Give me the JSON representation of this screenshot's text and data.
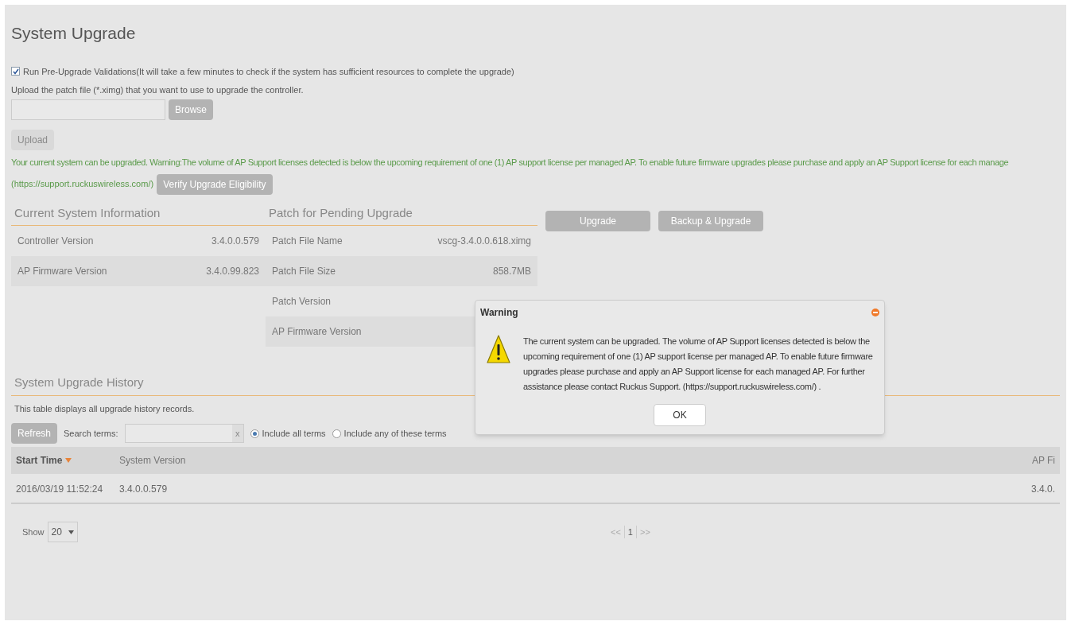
{
  "page": {
    "title": "System Upgrade"
  },
  "validation": {
    "checked": true,
    "label": "Run Pre-Upgrade Validations(It will take a few minutes to check if the system has sufficient resources to complete the upgrade)"
  },
  "upload": {
    "instruction": "Upload the patch file (*.ximg) that you want to use to upgrade the controller.",
    "browse": {
      "label": "Browse",
      "disabled": false
    },
    "upload": {
      "label": "Upload",
      "disabled": true
    }
  },
  "eligibility": {
    "message": "Your current system can be upgraded. Warning:The volume of AP Support licenses detected is below the upcoming requirement of one (1) AP support license per managed AP. To enable future firmware upgrades please purchase and apply an AP Support license for each manage",
    "link": "(https://support.ruckuswireless.com/)",
    "button": {
      "label": "Verify Upgrade Eligibility",
      "disabled": false
    }
  },
  "current_system": {
    "heading": "Current System Information",
    "rows": [
      {
        "label": "Controller Version",
        "value": "3.4.0.0.579"
      },
      {
        "label": "AP Firmware Version",
        "value": "3.4.0.99.823"
      }
    ]
  },
  "pending_patch": {
    "heading": "Patch for Pending Upgrade",
    "rows": [
      {
        "label": "Patch File Name",
        "value": "vscg-3.4.0.0.618.ximg"
      },
      {
        "label": "Patch File Size",
        "value": "858.7MB"
      },
      {
        "label": "Patch Version"
      },
      {
        "label": "AP Firmware Version"
      }
    ]
  },
  "actions": [
    {
      "label": "Upgrade",
      "disabled": false
    },
    {
      "label": "Backup & Upgrade",
      "disabled": false
    }
  ],
  "history": {
    "heading": "System Upgrade History",
    "description": "This table displays all upgrade history records.",
    "refresh": {
      "label": "Refresh",
      "disabled": false
    },
    "search_label": "Search terms:",
    "clear": "x",
    "options": [
      {
        "label": "Include all terms",
        "selected": true
      },
      {
        "label": "Include any of these terms",
        "selected": false
      }
    ],
    "columns": [
      {
        "label": "Start Time",
        "sorted": true
      },
      {
        "label": "System Version",
        "sorted": false
      },
      {
        "label": "AP Fi",
        "sorted": false
      }
    ],
    "rows": [
      [
        "2016/03/19 11:52:24",
        "3.4.0.0.579",
        "3.4.0."
      ]
    ],
    "show_label": "Show",
    "page_size": "20",
    "pagination": {
      "first": "<<",
      "page": "1",
      "last": ">>"
    }
  },
  "dialog": {
    "title": "Warning",
    "message": "The current system can be upgraded. The volume of AP Support licenses detected is below the upcoming requirement of one (1) AP support license per managed AP. To enable future firmware upgrades please purchase and apply an AP Support license for each managed AP. For further assistance please contact Ruckus Support. (https://support.ruckuswireless.com/) .",
    "ok": "OK"
  }
}
